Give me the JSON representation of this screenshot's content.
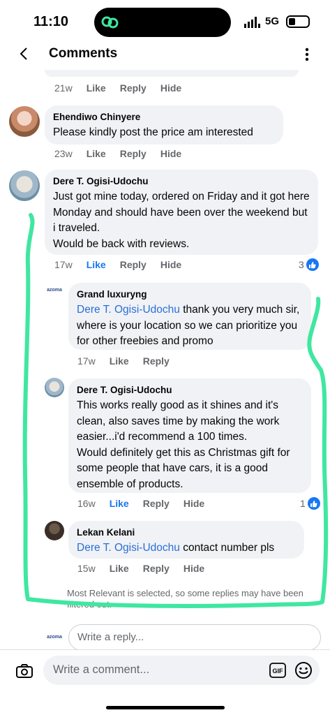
{
  "status_bar": {
    "time": "11:10",
    "network": "5G"
  },
  "header": {
    "title": "Comments"
  },
  "top_comment_actions": {
    "age": "21w",
    "like": "Like",
    "reply": "Reply",
    "hide": "Hide"
  },
  "comments": [
    {
      "author": "Ehendiwo Chinyere",
      "text": "Please kindly post the price am interested",
      "age": "23w",
      "like": "Like",
      "reply": "Reply",
      "hide": "Hide"
    },
    {
      "author": "Dere T. Ogisi-Udochu",
      "text": "Just got mine today, ordered on Friday and it got here Monday and should have been over the weekend but i traveled.\nWould be back with reviews.",
      "age": "17w",
      "like": "Like",
      "reply": "Reply",
      "hide": "Hide",
      "reactions": "3"
    }
  ],
  "replies": [
    {
      "author": "Grand luxuryng",
      "avatar_label": "azoma",
      "mention": "Dere T. Ogisi-Udochu",
      "text": " thank you very much sir, where is your location so we can prioritize you for other freebies and promo",
      "age": "17w",
      "like": "Like",
      "reply": "Reply"
    },
    {
      "author": "Dere T. Ogisi-Udochu",
      "text": "This works really good as it shines and it's clean, also saves time by making the work easier...i'd recommend a 100 times.\nWould definitely get this as Christmas gift for some people that have cars, it is a good ensemble of products.",
      "age": "16w",
      "like": "Like",
      "reply": "Reply",
      "hide": "Hide",
      "reactions": "1"
    },
    {
      "author": "Lekan Kelani",
      "mention": "Dere T. Ogisi-Udochu",
      "text": " contact number pls",
      "age": "15w",
      "like": "Like",
      "reply": "Reply",
      "hide": "Hide"
    }
  ],
  "notice": "Most Relevant is selected, so some replies may have been filtered out.",
  "reply_box": {
    "placeholder": "Write a reply...",
    "avatar_label": "azoma"
  },
  "comment_box": {
    "placeholder": "Write a comment...",
    "gif_label": "GIF"
  },
  "colors": {
    "mention": "#2a6fd8",
    "like_active": "#1877f2",
    "scribble": "#3fe7a0",
    "bubble": "#f0f2f5"
  },
  "icons": [
    "back-arrow-icon",
    "more-options-icon",
    "camera-icon",
    "gif-icon",
    "emoji-icon",
    "like-reaction-icon",
    "signal-icon",
    "battery-icon"
  ]
}
